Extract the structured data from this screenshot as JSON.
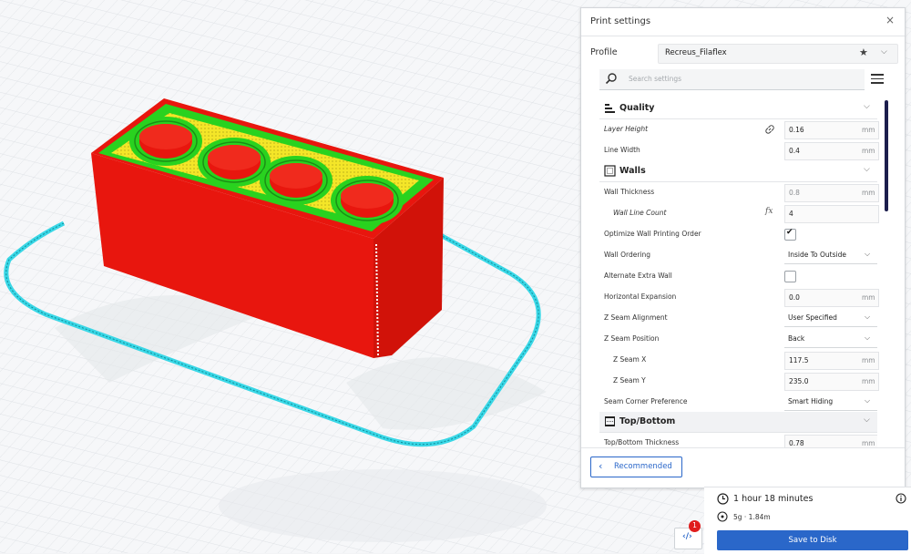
{
  "panel": {
    "title": "Print settings",
    "close": "×",
    "profile_label": "Profile",
    "profile_name": "Recreus_Filaflex",
    "star": "★",
    "chevron": "⌵",
    "search_placeholder": "Search settings"
  },
  "categories": {
    "quality": "Quality",
    "walls": "Walls",
    "topbottom": "Top/Bottom"
  },
  "rows": {
    "layer_height": {
      "label": "Layer Height",
      "value": "0.16",
      "unit": "mm"
    },
    "line_width": {
      "label": "Line Width",
      "value": "0.4",
      "unit": "mm"
    },
    "wall_thickness": {
      "label": "Wall Thickness",
      "value": "0.8",
      "unit": "mm"
    },
    "wall_line_count": {
      "label": "Wall Line Count",
      "value": "4",
      "fx": "fx"
    },
    "optimize_wall": {
      "label": "Optimize Wall Printing Order",
      "checked": true,
      "mark": "✔"
    },
    "wall_ordering": {
      "label": "Wall Ordering",
      "value": "Inside To Outside"
    },
    "alternate_wall": {
      "label": "Alternate Extra Wall",
      "checked": false
    },
    "horizontal_expansion": {
      "label": "Horizontal Expansion",
      "value": "0.0",
      "unit": "mm"
    },
    "z_seam_alignment": {
      "label": "Z Seam Alignment",
      "value": "User Specified"
    },
    "z_seam_position": {
      "label": "Z Seam Position",
      "value": "Back"
    },
    "z_seam_x": {
      "label": "Z Seam X",
      "value": "117.5",
      "unit": "mm"
    },
    "z_seam_y": {
      "label": "Z Seam Y",
      "value": "235.0",
      "unit": "mm"
    },
    "seam_corner": {
      "label": "Seam Corner Preference",
      "value": "Smart Hiding"
    },
    "topbottom_thickness": {
      "label": "Top/Bottom Thickness",
      "value": "0.78",
      "unit": "mm"
    }
  },
  "footer": {
    "recommended": "Recommended",
    "back_chevron": "‹"
  },
  "output": {
    "time": "1 hour 18 minutes",
    "material": "5g · 1.84m",
    "save": "Save to Disk"
  },
  "notifications": {
    "code": "‹/›",
    "count": "1"
  },
  "colors": {
    "accent": "#2a67c9",
    "model_walls": "#e8160e",
    "model_inner": "#29d21f",
    "model_infill": "#f2e61a",
    "skirt": "#39d7e6",
    "badge": "#e01d1d"
  }
}
